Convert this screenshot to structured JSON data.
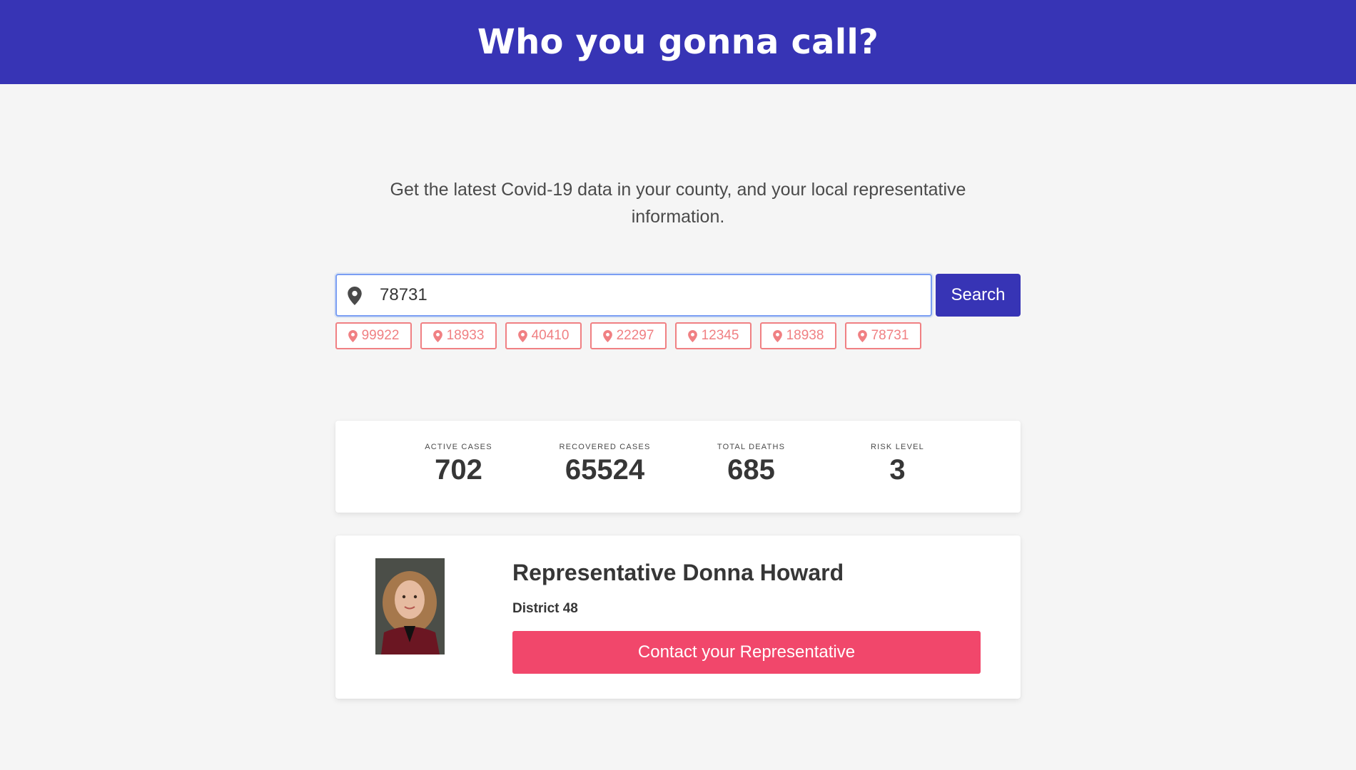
{
  "header": {
    "title": "Who you gonna call?"
  },
  "main": {
    "tagline": "Get the latest Covid-19 data in your county, and your local representative information.",
    "search": {
      "value": "78731",
      "button_label": "Search"
    },
    "recent_zips": [
      "99922",
      "18933",
      "40410",
      "22297",
      "12345",
      "18938",
      "78731"
    ]
  },
  "stats": [
    {
      "heading": "ACTIVE CASES",
      "value": "702"
    },
    {
      "heading": "RECOVERED CASES",
      "value": "65524"
    },
    {
      "heading": "TOTAL DEATHS",
      "value": "685"
    },
    {
      "heading": "RISK LEVEL",
      "value": "3"
    }
  ],
  "representative": {
    "name": "Representative Donna Howard",
    "district": "District 48",
    "contact_label": "Contact your Representative"
  },
  "colors": {
    "primary": "#3734b5",
    "chip": "#f08083",
    "contact": "#f1476b",
    "background": "#f5f5f5"
  }
}
